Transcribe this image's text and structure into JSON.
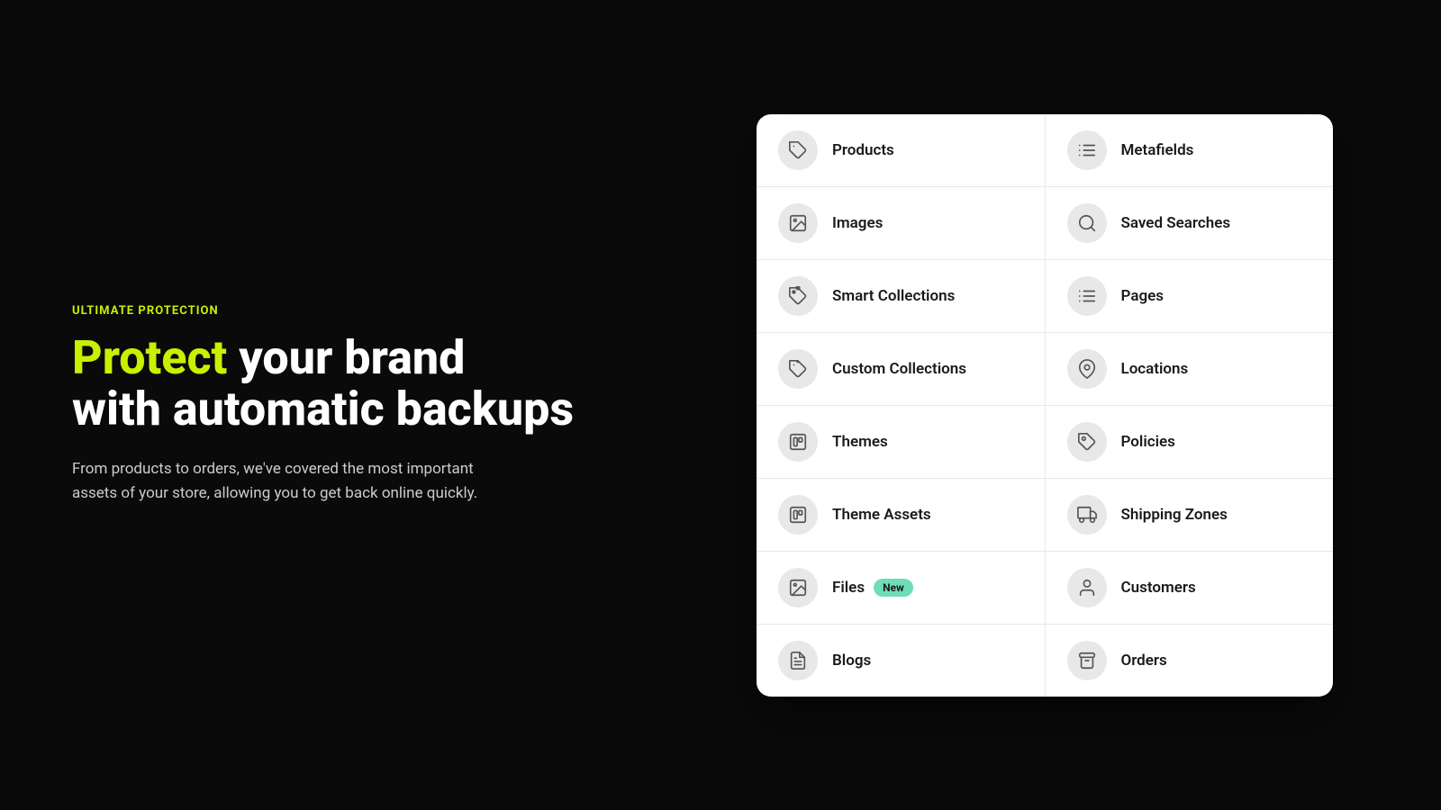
{
  "left": {
    "eyebrow": "ULTIMATE PROTECTION",
    "headline_part1": "Protect",
    "headline_part2": " your brand",
    "headline_line2": "with automatic backups",
    "description": "From products to orders, we've covered the most important assets of your store, allowing you to get back online quickly."
  },
  "grid": {
    "rows": [
      {
        "left": {
          "label": "Products",
          "icon": "tag",
          "badge": null
        },
        "right": {
          "label": "Metafields",
          "icon": "list-detail",
          "badge": null
        }
      },
      {
        "left": {
          "label": "Images",
          "icon": "image",
          "badge": null
        },
        "right": {
          "label": "Saved Searches",
          "icon": "search",
          "badge": null
        }
      },
      {
        "left": {
          "label": "Smart Collections",
          "icon": "smart-collect",
          "badge": null
        },
        "right": {
          "label": "Pages",
          "icon": "list-detail",
          "badge": null
        }
      },
      {
        "left": {
          "label": "Custom Collections",
          "icon": "custom-collect",
          "badge": null
        },
        "right": {
          "label": "Locations",
          "icon": "location",
          "badge": null
        }
      },
      {
        "left": {
          "label": "Themes",
          "icon": "themes",
          "badge": null
        },
        "right": {
          "label": "Policies",
          "icon": "policy",
          "badge": null
        }
      },
      {
        "left": {
          "label": "Theme Assets",
          "icon": "themes",
          "badge": null
        },
        "right": {
          "label": "Shipping Zones",
          "icon": "shipping",
          "badge": null
        }
      },
      {
        "left": {
          "label": "Files",
          "icon": "image",
          "badge": "New"
        },
        "right": {
          "label": "Customers",
          "icon": "customer",
          "badge": null
        }
      },
      {
        "left": {
          "label": "Blogs",
          "icon": "blog",
          "badge": null
        },
        "right": {
          "label": "Orders",
          "icon": "orders",
          "badge": null
        }
      }
    ]
  }
}
